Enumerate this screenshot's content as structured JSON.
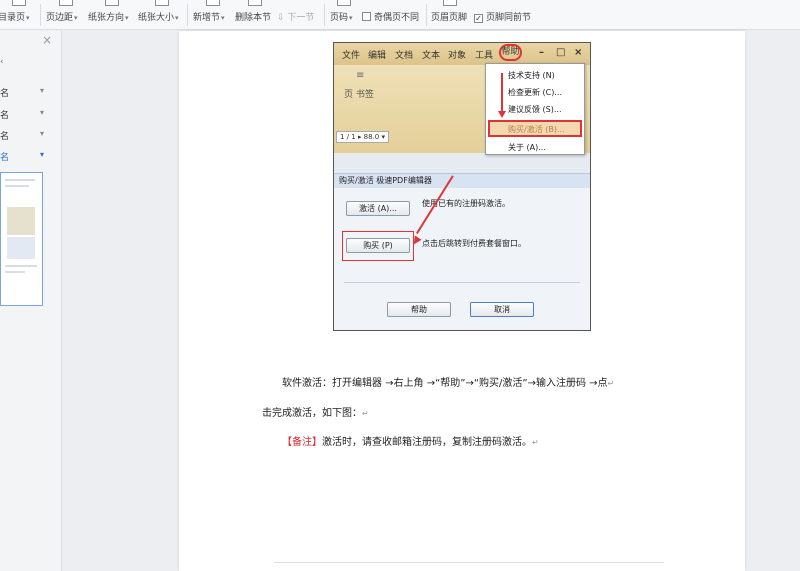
{
  "ribbon": {
    "items": [
      {
        "label": "目录页",
        "dropdown": true
      },
      {
        "label": "页边距",
        "dropdown": true
      },
      {
        "label": "纸张方向",
        "dropdown": true
      },
      {
        "label": "纸张大小",
        "dropdown": true
      },
      {
        "label": "新增节",
        "dropdown": true
      },
      {
        "label": "删除本节",
        "dropdown": false
      },
      {
        "label": "下一节",
        "dropdown": false
      },
      {
        "label": "页码",
        "dropdown": true
      },
      {
        "label": "奇偶页不同",
        "checkbox": true,
        "checked": false
      },
      {
        "label": "页眉页脚",
        "dropdown": false
      },
      {
        "label": "页脚同前节",
        "checkbox": true,
        "checked": true
      }
    ]
  },
  "nav": {
    "close": "×",
    "collapse_arrow": "‹",
    "items": [
      {
        "label": "名",
        "caret": "▾"
      },
      {
        "label": "名",
        "caret": "▾"
      },
      {
        "label": "名",
        "caret": "▾"
      },
      {
        "label": "名",
        "caret": "▾",
        "active": true
      }
    ]
  },
  "screenshot": {
    "menu": [
      "文件",
      "编辑",
      "文档",
      "文本",
      "对象",
      "工具"
    ],
    "menu_help": "帮助",
    "window_controls": [
      "–",
      "□",
      "×"
    ],
    "ribbon_lines": "≡",
    "bookmark_text": "页  书签",
    "status_box": "1 / 1 ▸ 88.0 ▾",
    "dropdown": {
      "items": [
        "技术支持 (N)",
        "检查更新 (C)...",
        "建议反馈 (S)..."
      ],
      "highlighted": "购买/激活 (B)...",
      "last": "关于 (A)..."
    },
    "dialog": {
      "title": "购买/激活 极速PDF编辑器",
      "activate_button": "激活 (A)...",
      "activate_text": "使用已有的注册码激活。",
      "buy_button": "购买 (P)",
      "buy_text": "点击后跳转到付费套餐窗口。",
      "help_button": "帮助",
      "cancel_button": "取消"
    }
  },
  "document": {
    "para1": "软件激活：打开编辑器 →右上角 →“帮助”→“购买/激活”→输入注册码 →点",
    "para1_mark": "↵",
    "para2": "击完成激活，如下图：",
    "para2_mark": "↵",
    "note_tag": "【备注】",
    "note_text": "激活时，请查收邮箱注册码，复制注册码激活。",
    "note_mark": "↵"
  }
}
